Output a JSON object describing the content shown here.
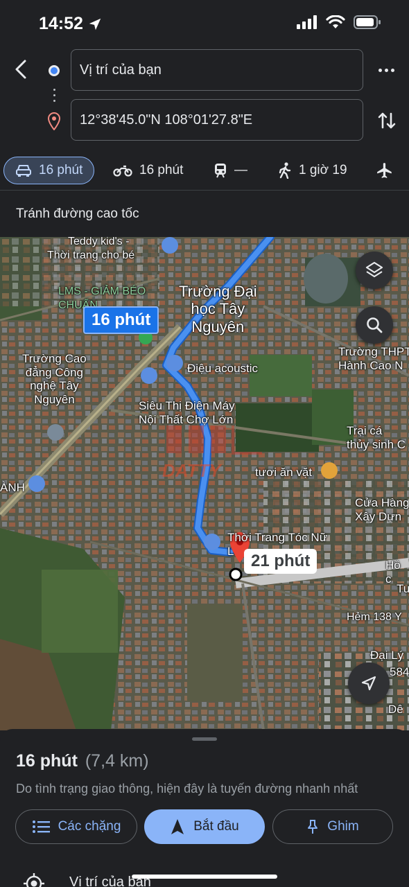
{
  "status": {
    "time": "14:52"
  },
  "route": {
    "origin": "Vị trí của bạn",
    "destination": "12°38'45.0\"N 108°01'27.8\"E"
  },
  "modes": [
    {
      "name": "car",
      "label": "16 phút",
      "active": true
    },
    {
      "name": "motorbike",
      "label": "16 phút",
      "active": false
    },
    {
      "name": "transit",
      "label": "—",
      "active": false
    },
    {
      "name": "walk",
      "label": "1 giờ 19",
      "active": false
    },
    {
      "name": "flight",
      "label": "",
      "active": false
    }
  ],
  "options": {
    "avoid_label": "Tránh đường cao tốc"
  },
  "map": {
    "eta_main": "16 phút",
    "eta_alt": "21 phút",
    "labels": {
      "teddy": "Teddy kid's -",
      "teddy2": "Thời trang cho bé",
      "lms": "LMS - GIẢM BÉO",
      "lms2": "CHUẨN",
      "university": "Trường Đại\nhọc Tây\nNguyên",
      "college": "Trường Cao\nđẳng Công\nnghệ Tây\nNguyên",
      "dieu": "Điệu acoustic",
      "sieuthi": "Siêu Thị Điện Máy\nNội Thất Chợ Lớn",
      "thpt": "Trường THPT\nHành Cao N",
      "traica": "Trại cá\nthủy sinh C",
      "tuoi": "tươi ăn vặt",
      "cuahang": "Cửa Hàng\nXây Dựn",
      "anh": "ÀNH",
      "thoitrang": "Thời Trang Tóc Nữ",
      "thoitrang2": "L",
      "ho": "Hồ c",
      "tu": "Tu",
      "hem": "Hẻm 138 Y",
      "daily": "Đại Lý",
      "daily2": "584",
      "de": "Dê",
      "watermark": "DATTY"
    }
  },
  "sheet": {
    "duration": "16 phút",
    "distance": "(7,4 km)",
    "description": "Do tình trạng giao thông, hiện đây là tuyến đường nhanh nhất",
    "steps_label": "Các chặng",
    "start_label": "Bắt đầu",
    "pin_label": "Ghim",
    "origin_row": "Vị trí của bạn"
  },
  "colors": {
    "route_blue": "#4a90f0",
    "accent": "#8ab4f8",
    "background": "#202124",
    "destination_pin": "#ea4335"
  }
}
